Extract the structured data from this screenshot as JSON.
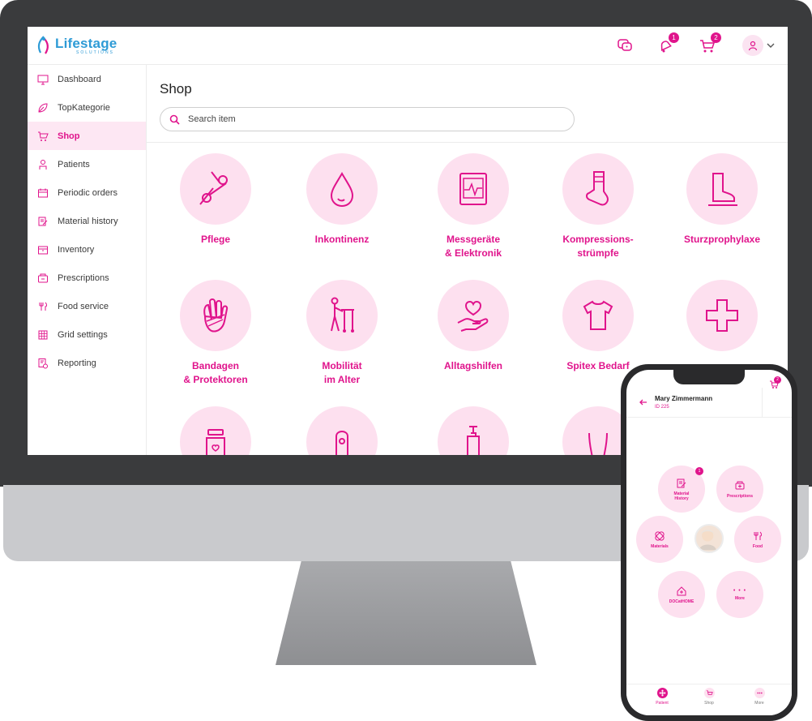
{
  "brand": {
    "name": "Lifestage",
    "sub": "SOLUTIONS"
  },
  "header": {
    "notifications_count": "1",
    "cart_count": "2"
  },
  "sidebar": {
    "items": [
      {
        "label": "Dashboard",
        "icon": "monitor-icon",
        "active": false
      },
      {
        "label": "TopKategorie",
        "icon": "leaf-icon",
        "active": false
      },
      {
        "label": "Shop",
        "icon": "cart-icon",
        "active": true
      },
      {
        "label": "Patients",
        "icon": "person-icon",
        "active": false
      },
      {
        "label": "Periodic orders",
        "icon": "calendar-icon",
        "active": false
      },
      {
        "label": "Material history",
        "icon": "edit-doc-icon",
        "active": false
      },
      {
        "label": "Inventory",
        "icon": "box-icon",
        "active": false
      },
      {
        "label": "Prescriptions",
        "icon": "prescription-icon",
        "active": false
      },
      {
        "label": "Food service",
        "icon": "cutlery-icon",
        "active": false
      },
      {
        "label": "Grid settings",
        "icon": "grid-icon",
        "active": false
      },
      {
        "label": "Reporting",
        "icon": "report-icon",
        "active": false
      }
    ]
  },
  "main": {
    "title": "Shop",
    "search": {
      "placeholder": "Search item",
      "value": ""
    },
    "categories": [
      {
        "line1": "Pflege",
        "line2": "",
        "icon": "scissors-icon"
      },
      {
        "line1": "Inkontinenz",
        "line2": "",
        "icon": "drop-icon"
      },
      {
        "line1": "Messgeräte",
        "line2": "& Elektronik",
        "icon": "monitor-pulse-icon"
      },
      {
        "line1": "Kompressions-",
        "line2": "strümpfe",
        "icon": "sock-icon"
      },
      {
        "line1": "Sturzprophylaxe",
        "line2": "",
        "icon": "foot-icon"
      },
      {
        "line1": "Bandagen",
        "line2": "& Protektoren",
        "icon": "bandaged-hand-icon"
      },
      {
        "line1": "Mobilität",
        "line2": "im Alter",
        "icon": "walker-icon"
      },
      {
        "line1": "Alltagshilfen",
        "line2": "",
        "icon": "heart-hand-icon"
      },
      {
        "line1": "Spitex Bedarf",
        "line2": "",
        "icon": "shirt-icon"
      },
      {
        "line1": "",
        "line2": "",
        "icon": "medical-cross-icon"
      },
      {
        "line1": "",
        "line2": "",
        "icon": "jar-icon"
      },
      {
        "line1": "",
        "line2": "",
        "icon": "spray-icon"
      },
      {
        "line1": "",
        "line2": "",
        "icon": "pump-bottle-icon"
      },
      {
        "line1": "",
        "line2": "",
        "icon": "body-icon"
      }
    ]
  },
  "phone": {
    "patient_name": "Mary Zimmermann",
    "patient_id": "ID 225",
    "cart_count": "2",
    "bubbles": {
      "material_history": {
        "line1": "Material",
        "line2": "History",
        "badge": "1"
      },
      "prescriptions": {
        "label": "Prescriptions"
      },
      "materials": {
        "label": "Materials"
      },
      "food": {
        "label": "Food"
      },
      "doc_home": {
        "label": "DOCatHOME"
      },
      "more": {
        "label": "More",
        "dots": "• • •"
      }
    },
    "tabs": [
      {
        "label": "Patient",
        "active": true
      },
      {
        "label": "Shop",
        "active": false
      },
      {
        "label": "More",
        "active": false
      }
    ]
  },
  "colors": {
    "accent": "#e0148c",
    "accent_soft": "#fde0ef",
    "brand_blue": "#2e9bd6"
  }
}
